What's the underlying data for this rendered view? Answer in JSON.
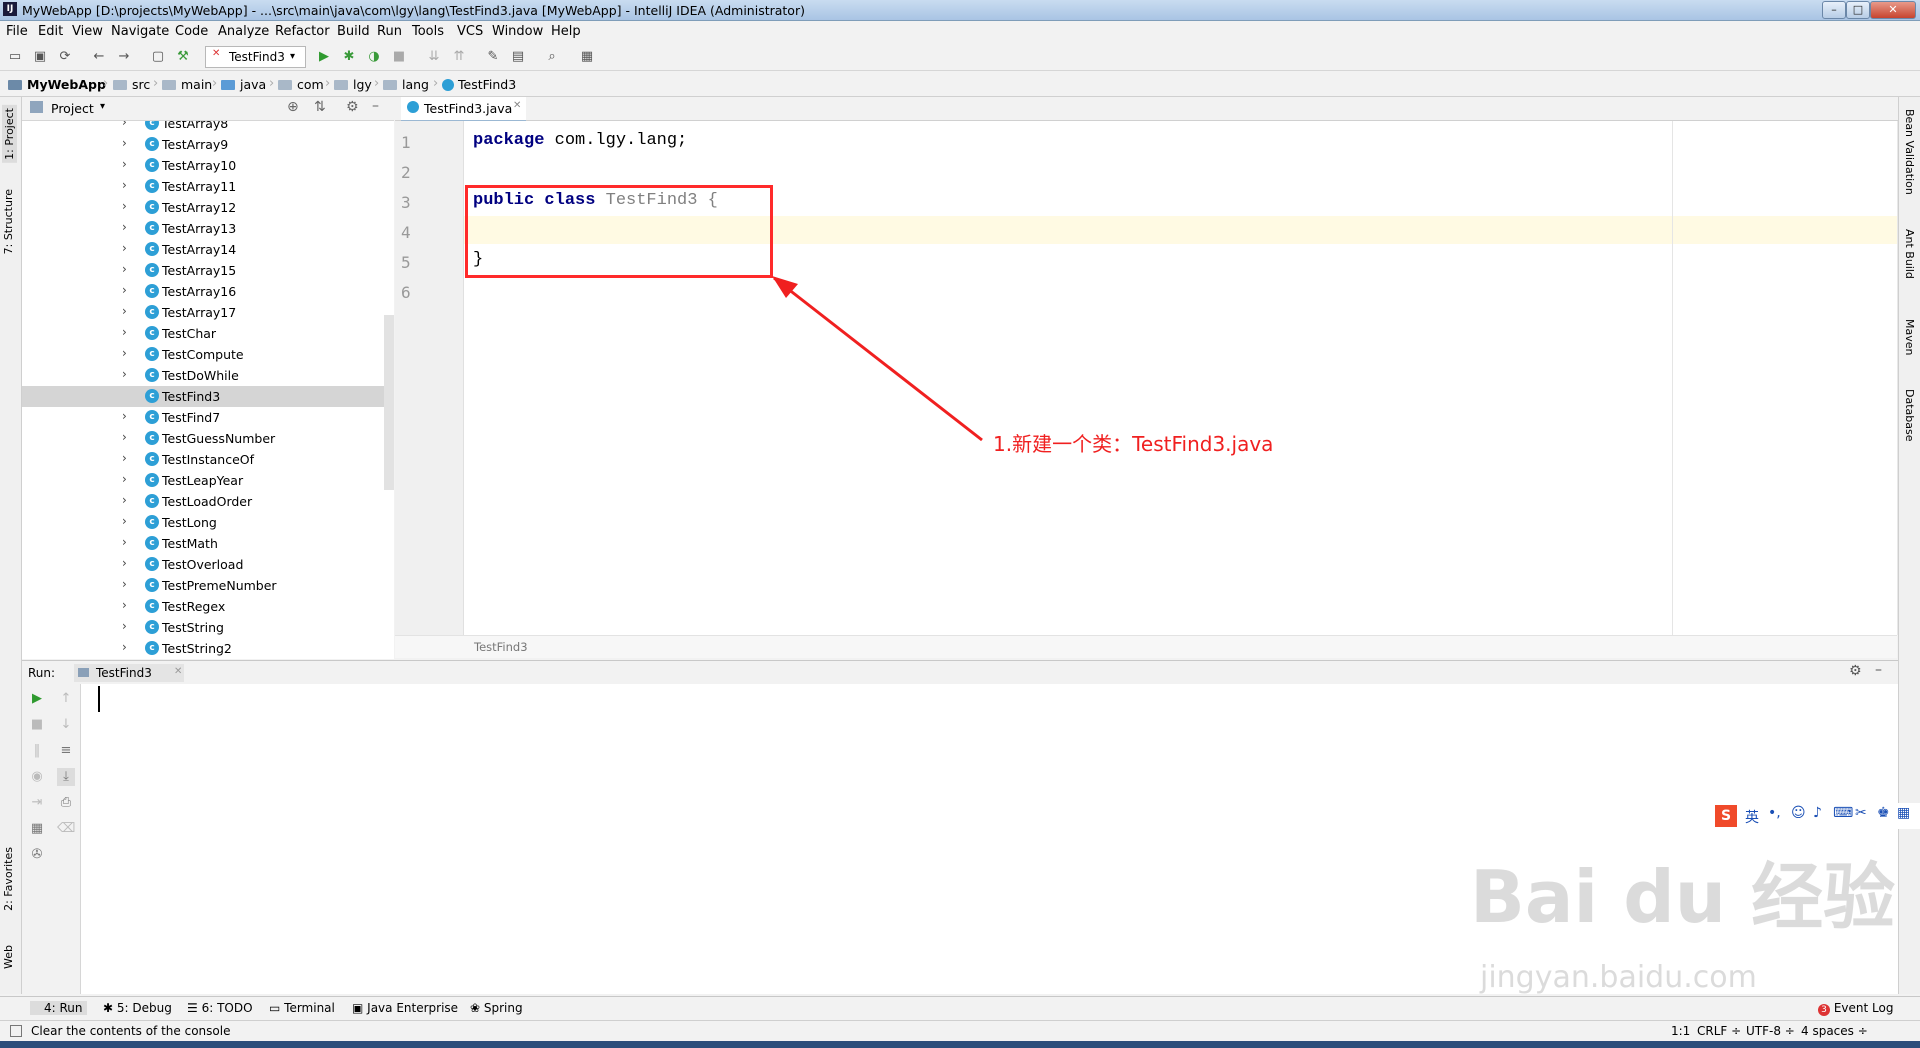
{
  "window": {
    "title": "MyWebApp [D:\\projects\\MyWebApp] - ...\\src\\main\\java\\com\\lgy\\lang\\TestFind3.java [MyWebApp] - IntelliJ IDEA (Administrator)",
    "app_icon": "IJ"
  },
  "menu": [
    "File",
    "Edit",
    "View",
    "Navigate",
    "Code",
    "Analyze",
    "Refactor",
    "Build",
    "Run",
    "Tools",
    "VCS",
    "Window",
    "Help"
  ],
  "toolbar": {
    "run_config": "TestFind3"
  },
  "breadcrumb": [
    "MyWebApp",
    "src",
    "main",
    "java",
    "com",
    "lgy",
    "lang",
    "TestFind3"
  ],
  "left_strip": {
    "project": "1: Project",
    "structure": "7: Structure",
    "favorites": "2: Favorites",
    "web": "Web"
  },
  "project_panel": {
    "title": "Project",
    "items": [
      {
        "label": "TestArray8",
        "selected": false
      },
      {
        "label": "TestArray9",
        "selected": false
      },
      {
        "label": "TestArray10",
        "selected": false
      },
      {
        "label": "TestArray11",
        "selected": false
      },
      {
        "label": "TestArray12",
        "selected": false
      },
      {
        "label": "TestArray13",
        "selected": false
      },
      {
        "label": "TestArray14",
        "selected": false
      },
      {
        "label": "TestArray15",
        "selected": false
      },
      {
        "label": "TestArray16",
        "selected": false
      },
      {
        "label": "TestArray17",
        "selected": false
      },
      {
        "label": "TestChar",
        "selected": false
      },
      {
        "label": "TestCompute",
        "selected": false
      },
      {
        "label": "TestDoWhile",
        "selected": false
      },
      {
        "label": "TestFind3",
        "selected": true
      },
      {
        "label": "TestFind7",
        "selected": false
      },
      {
        "label": "TestGuessNumber",
        "selected": false
      },
      {
        "label": "TestInstanceOf",
        "selected": false
      },
      {
        "label": "TestLeapYear",
        "selected": false
      },
      {
        "label": "TestLoadOrder",
        "selected": false
      },
      {
        "label": "TestLong",
        "selected": false
      },
      {
        "label": "TestMath",
        "selected": false
      },
      {
        "label": "TestOverload",
        "selected": false
      },
      {
        "label": "TestPremeNumber",
        "selected": false
      },
      {
        "label": "TestRegex",
        "selected": false
      },
      {
        "label": "TestString",
        "selected": false
      },
      {
        "label": "TestString2",
        "selected": false
      }
    ]
  },
  "editor": {
    "tab": "TestFind3.java",
    "line_numbers": [
      "1",
      "2",
      "3",
      "4",
      "5",
      "6"
    ],
    "code": {
      "line1_kw": "package",
      "line1_rest": " com.lgy.lang;",
      "line3_kw": "public class",
      "line3_name": " TestFind3",
      "line3_brace": " {",
      "line5": "}"
    },
    "status": "TestFind3"
  },
  "right_strip": [
    "Bean Validation",
    "Ant Build",
    "Maven",
    "Database"
  ],
  "run_panel": {
    "label": "Run:",
    "tab": "TestFind3"
  },
  "bottom_tools": [
    {
      "label": "4: Run"
    },
    {
      "label": "5: Debug"
    },
    {
      "label": "6: TODO"
    },
    {
      "label": "Terminal"
    },
    {
      "label": "Java Enterprise"
    },
    {
      "label": "Spring"
    }
  ],
  "event_log": {
    "count": "3",
    "label": "Event Log"
  },
  "status_bar": {
    "message": "Clear the contents of the console",
    "position": "1:1",
    "line_sep": "CRLF",
    "encoding": "UTF-8",
    "indent": "4 spaces"
  },
  "annotation": {
    "text": "1.新建一个类：TestFind3.java",
    "color": "#f02020"
  },
  "ime": {
    "lang": "英"
  },
  "watermark": {
    "brand": "Bai du 经验",
    "url": "jingyan.baidu.com"
  },
  "colors": {
    "keyword": "#000080",
    "class_name": "#808080",
    "selection": "#d5d5d5",
    "current_line": "#fffae3",
    "class_icon": "#2d9fd6"
  }
}
